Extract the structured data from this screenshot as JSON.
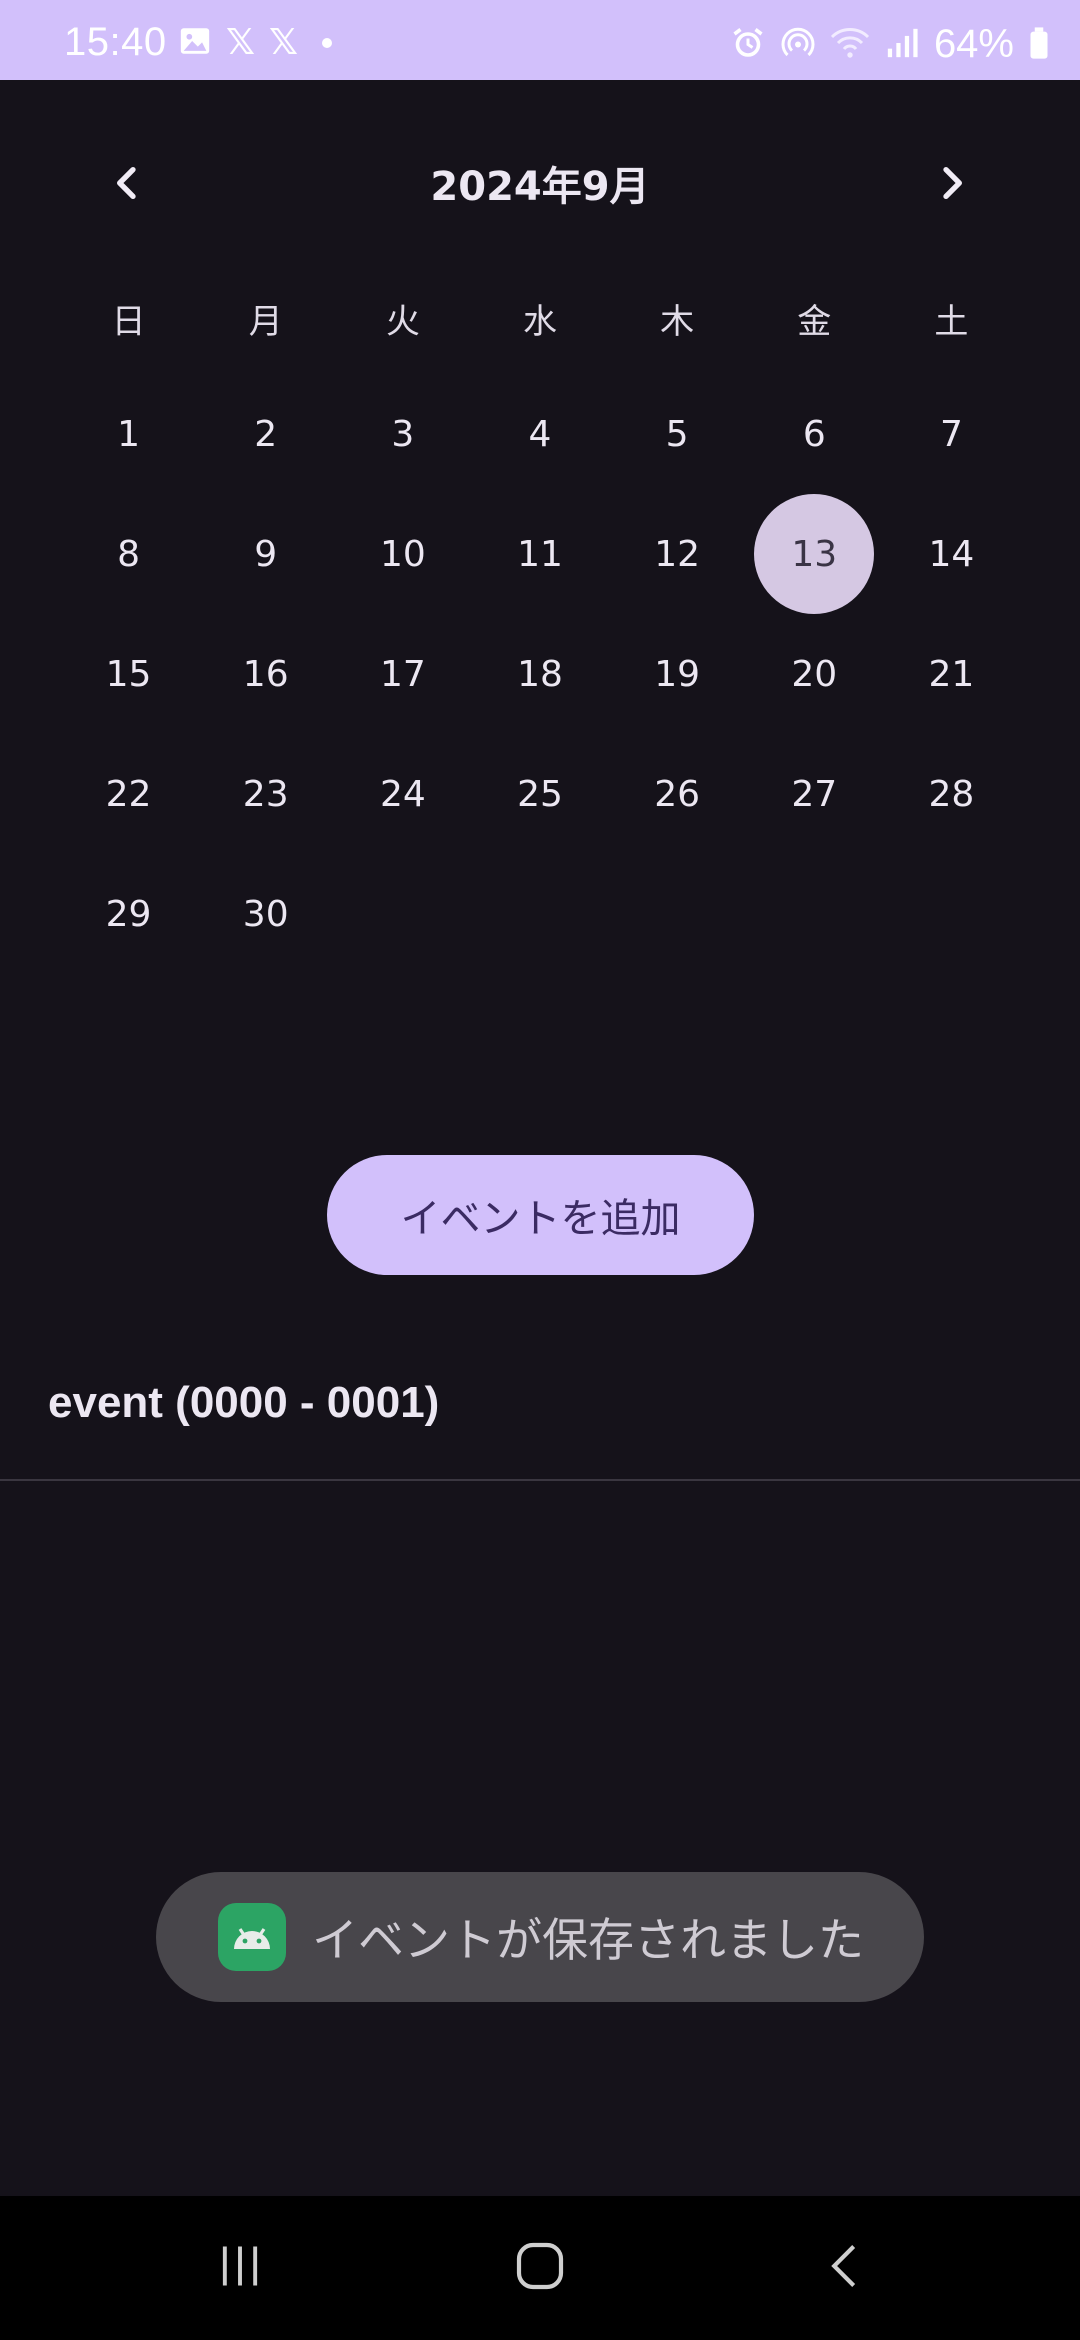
{
  "status_bar": {
    "time": "15:40",
    "battery": "64%",
    "left_icons": [
      "gallery-icon",
      "x-icon",
      "x-icon",
      "dot-icon"
    ],
    "right_icons": [
      "alarm-icon",
      "hotspot-icon",
      "wifi-icon",
      "signal-icon",
      "battery-icon"
    ],
    "x_glyph": "𝕏"
  },
  "calendar": {
    "month_title": "2024年9月",
    "weekdays": [
      "日",
      "月",
      "火",
      "水",
      "木",
      "金",
      "土"
    ],
    "weeks": [
      [
        "1",
        "2",
        "3",
        "4",
        "5",
        "6",
        "7"
      ],
      [
        "8",
        "9",
        "10",
        "11",
        "12",
        "13",
        "14"
      ],
      [
        "15",
        "16",
        "17",
        "18",
        "19",
        "20",
        "21"
      ],
      [
        "22",
        "23",
        "24",
        "25",
        "26",
        "27",
        "28"
      ],
      [
        "29",
        "30",
        "",
        "",
        "",
        "",
        ""
      ]
    ],
    "selected_day": "13"
  },
  "add_event_button": {
    "label": "イベントを追加"
  },
  "events": [
    {
      "label": "event (0000 - 0001)"
    }
  ],
  "toast": {
    "message": "イベントが保存されました"
  },
  "colors": {
    "accent": "#d2c0fb",
    "background": "#15121a",
    "selected_day": "#d5c8e3",
    "toast_bg": "#48464b"
  }
}
